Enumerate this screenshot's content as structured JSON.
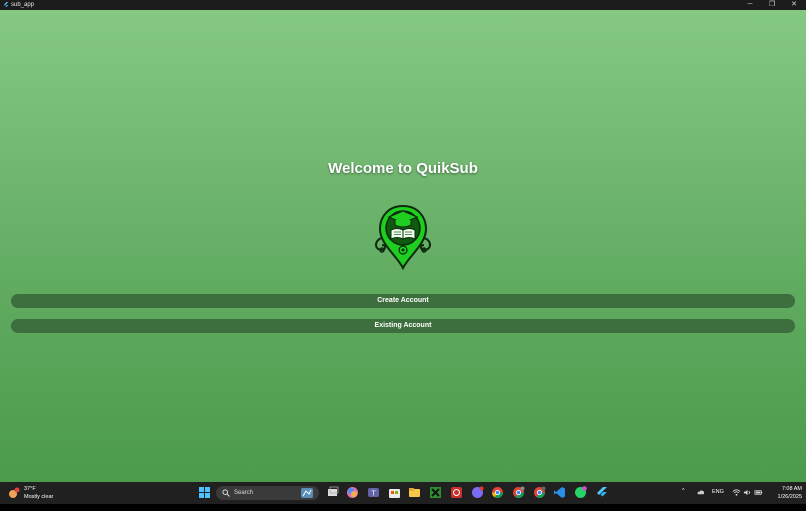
{
  "window": {
    "title": "sub_app",
    "controls": {
      "minimize": "─",
      "maximize": "❐",
      "close": "✕"
    }
  },
  "app": {
    "heading": "Welcome to QuikSub",
    "buttons": {
      "create": "Create Account",
      "existing": "Existing Account"
    },
    "colors": {
      "accent": "#3d6e3d",
      "bg_top": "#84c884",
      "bg_bottom": "#4c9a4c",
      "logo": "#1fcf1f"
    }
  },
  "taskbar": {
    "weather": {
      "temp": "37°F",
      "condition": "Mostly clear"
    },
    "search_placeholder": "Search",
    "tray": {
      "lang": "ENG"
    },
    "clock": {
      "time": "7:08 AM",
      "date": "1/26/2025"
    },
    "icons": [
      "windows-start-icon",
      "search-icon",
      "task-view-icon",
      "copilot-icon",
      "teams-icon",
      "store-icon",
      "file-explorer-icon",
      "xbox-icon",
      "app-red-icon",
      "messenger-icon",
      "chrome-icon",
      "chrome-profile-icon",
      "chrome-profile2-icon",
      "vscode-icon",
      "whatsapp-icon",
      "flutter-icon"
    ]
  }
}
